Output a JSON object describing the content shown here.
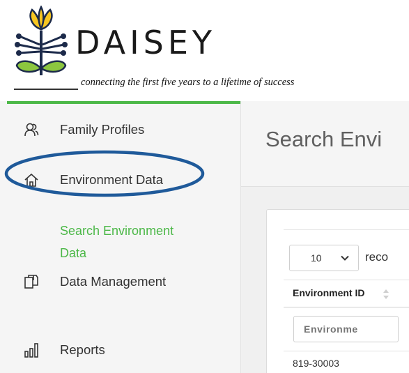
{
  "brand": {
    "name": "DAISEY",
    "tagline": "connecting the first five years to a lifetime of success",
    "colors": {
      "accent_green": "#4cb848",
      "flower_yellow": "#f7c621",
      "leaf_green": "#8cc63f",
      "stem_navy": "#1c2a4a",
      "highlight_blue": "#1f5a9a"
    }
  },
  "sidebar": {
    "items": [
      {
        "label": "Family Profiles",
        "icon": "people-icon"
      },
      {
        "label": "Environment Data",
        "icon": "home-icon"
      },
      {
        "label": "Data Management",
        "icon": "copy-docs-icon"
      },
      {
        "label": "Reports",
        "icon": "bar-chart-icon"
      }
    ],
    "subitem": {
      "label_line1": "Search Environment",
      "label_line2": "Data"
    }
  },
  "main": {
    "title": "Search Envi",
    "length_select_value": "10",
    "records_text": "reco",
    "column_header": "Environment ID",
    "filter_placeholder": "Environme",
    "first_row_id": "819-30003"
  }
}
